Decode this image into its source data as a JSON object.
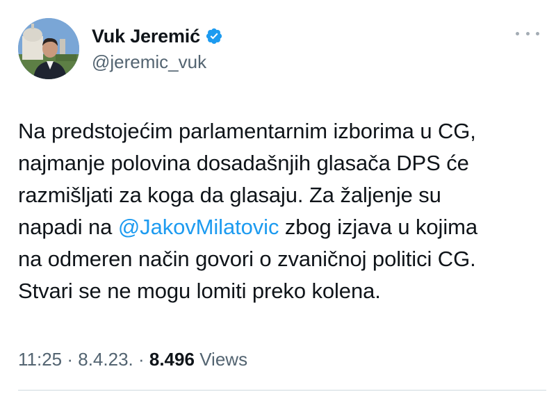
{
  "author": {
    "display_name": "Vuk Jeremić",
    "handle": "@jeremic_vuk",
    "verified": true
  },
  "tweet": {
    "lines": [
      {
        "before": "Na predstojećim parlamentarnim izborima u CG,"
      },
      {
        "before": "najmanje polovina dosadašnjih glasača DPS će"
      },
      {
        "before": "razmišljati za koga da glasaju. Za žaljenje su"
      },
      {
        "before": "napadi na ",
        "mention": "@JakovMilatovic",
        "after": " zbog izjava u kojima"
      },
      {
        "before": "na odmeren način govori o zvaničnoj politici CG."
      },
      {
        "before": "Stvari se ne mogu lomiti preko kolena."
      }
    ]
  },
  "meta": {
    "time": "11:25",
    "sep1": " · ",
    "date": "8.4.23.",
    "sep2": " · ",
    "views_count": "8.496",
    "views_label": "Views"
  },
  "colors": {
    "accent": "#1d9bf0",
    "secondary_text": "#536471",
    "primary_text": "#0f1419"
  },
  "icons": {
    "verified": "verified-badge-icon",
    "more": "more-options-icon"
  }
}
